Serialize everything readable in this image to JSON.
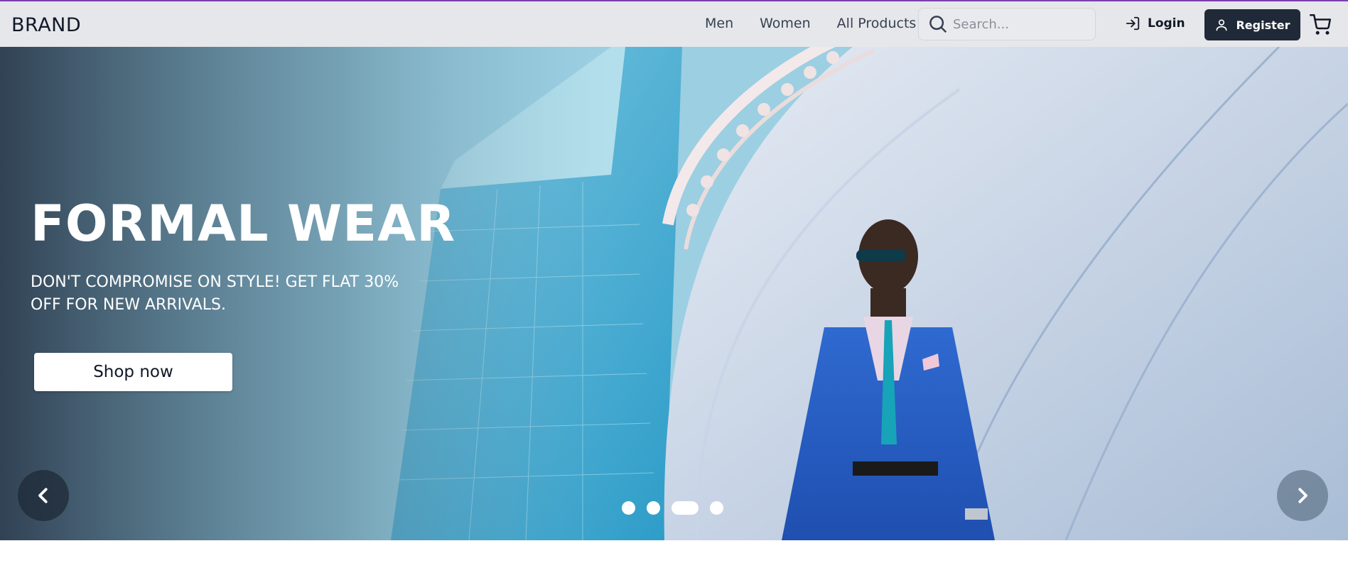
{
  "header": {
    "brand": "BRAND",
    "nav": [
      "Men",
      "Women",
      "All Products"
    ],
    "search_placeholder": "Search...",
    "login_label": "Login",
    "register_label": "Register"
  },
  "hero": {
    "title": "FORMAL WEAR",
    "subtitle": "DON'T COMPROMISE ON STYLE! GET FLAT 30% OFF FOR NEW ARRIVALS.",
    "cta_label": "Shop now",
    "slides_total": 4,
    "active_slide": 3
  },
  "colors": {
    "accent_line": "#7b3fb0",
    "header_bg": "#e6e7eb",
    "register_bg": "#1f2937"
  },
  "icons": [
    "search-icon",
    "login-icon",
    "user-icon",
    "cart-icon",
    "chevron-left-icon",
    "chevron-right-icon"
  ]
}
